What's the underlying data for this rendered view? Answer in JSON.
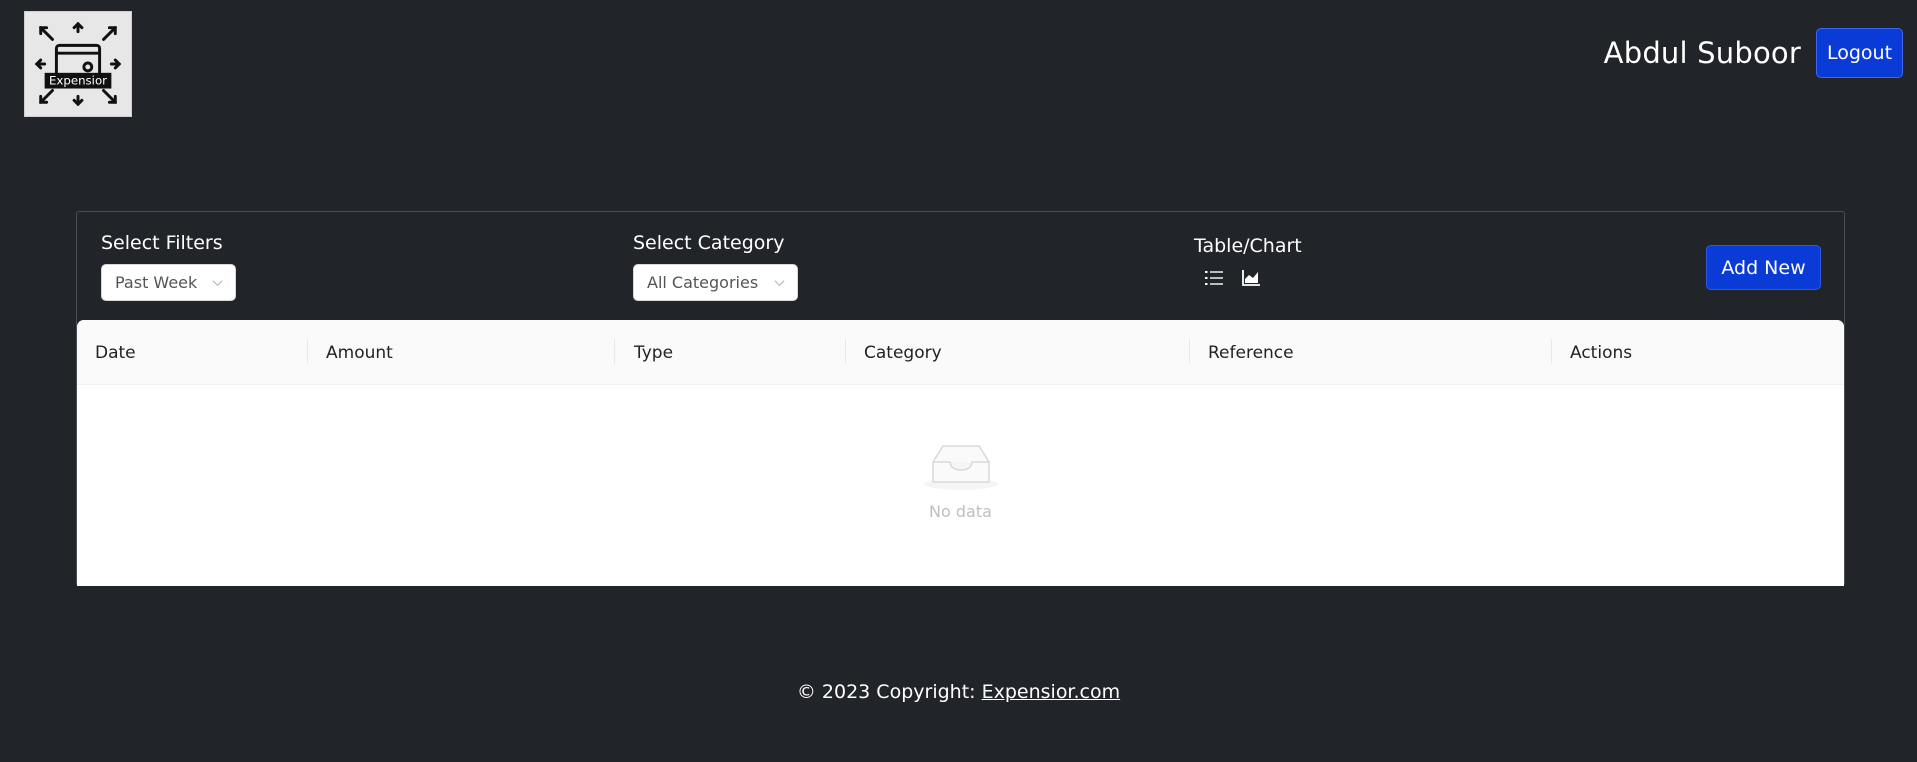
{
  "header": {
    "logo_text": "Expensior",
    "user_name": "Abdul Suboor",
    "logout_label": "Logout"
  },
  "filters": {
    "filter_label": "Select Filters",
    "filter_value": "Past Week",
    "category_label": "Select Category",
    "category_value": "All Categories",
    "view_label": "Table/Chart",
    "view_icons": [
      "list-icon",
      "area-chart-icon"
    ],
    "add_label": "Add New"
  },
  "table": {
    "columns": [
      "Date",
      "Amount",
      "Type",
      "Category",
      "Reference",
      "Actions"
    ],
    "empty_text": "No data"
  },
  "footer": {
    "copyright": "© 2023 Copyright: ",
    "link_text": "Expensior.com"
  },
  "colors": {
    "background": "#212429",
    "accent": "#0b3bd6"
  }
}
